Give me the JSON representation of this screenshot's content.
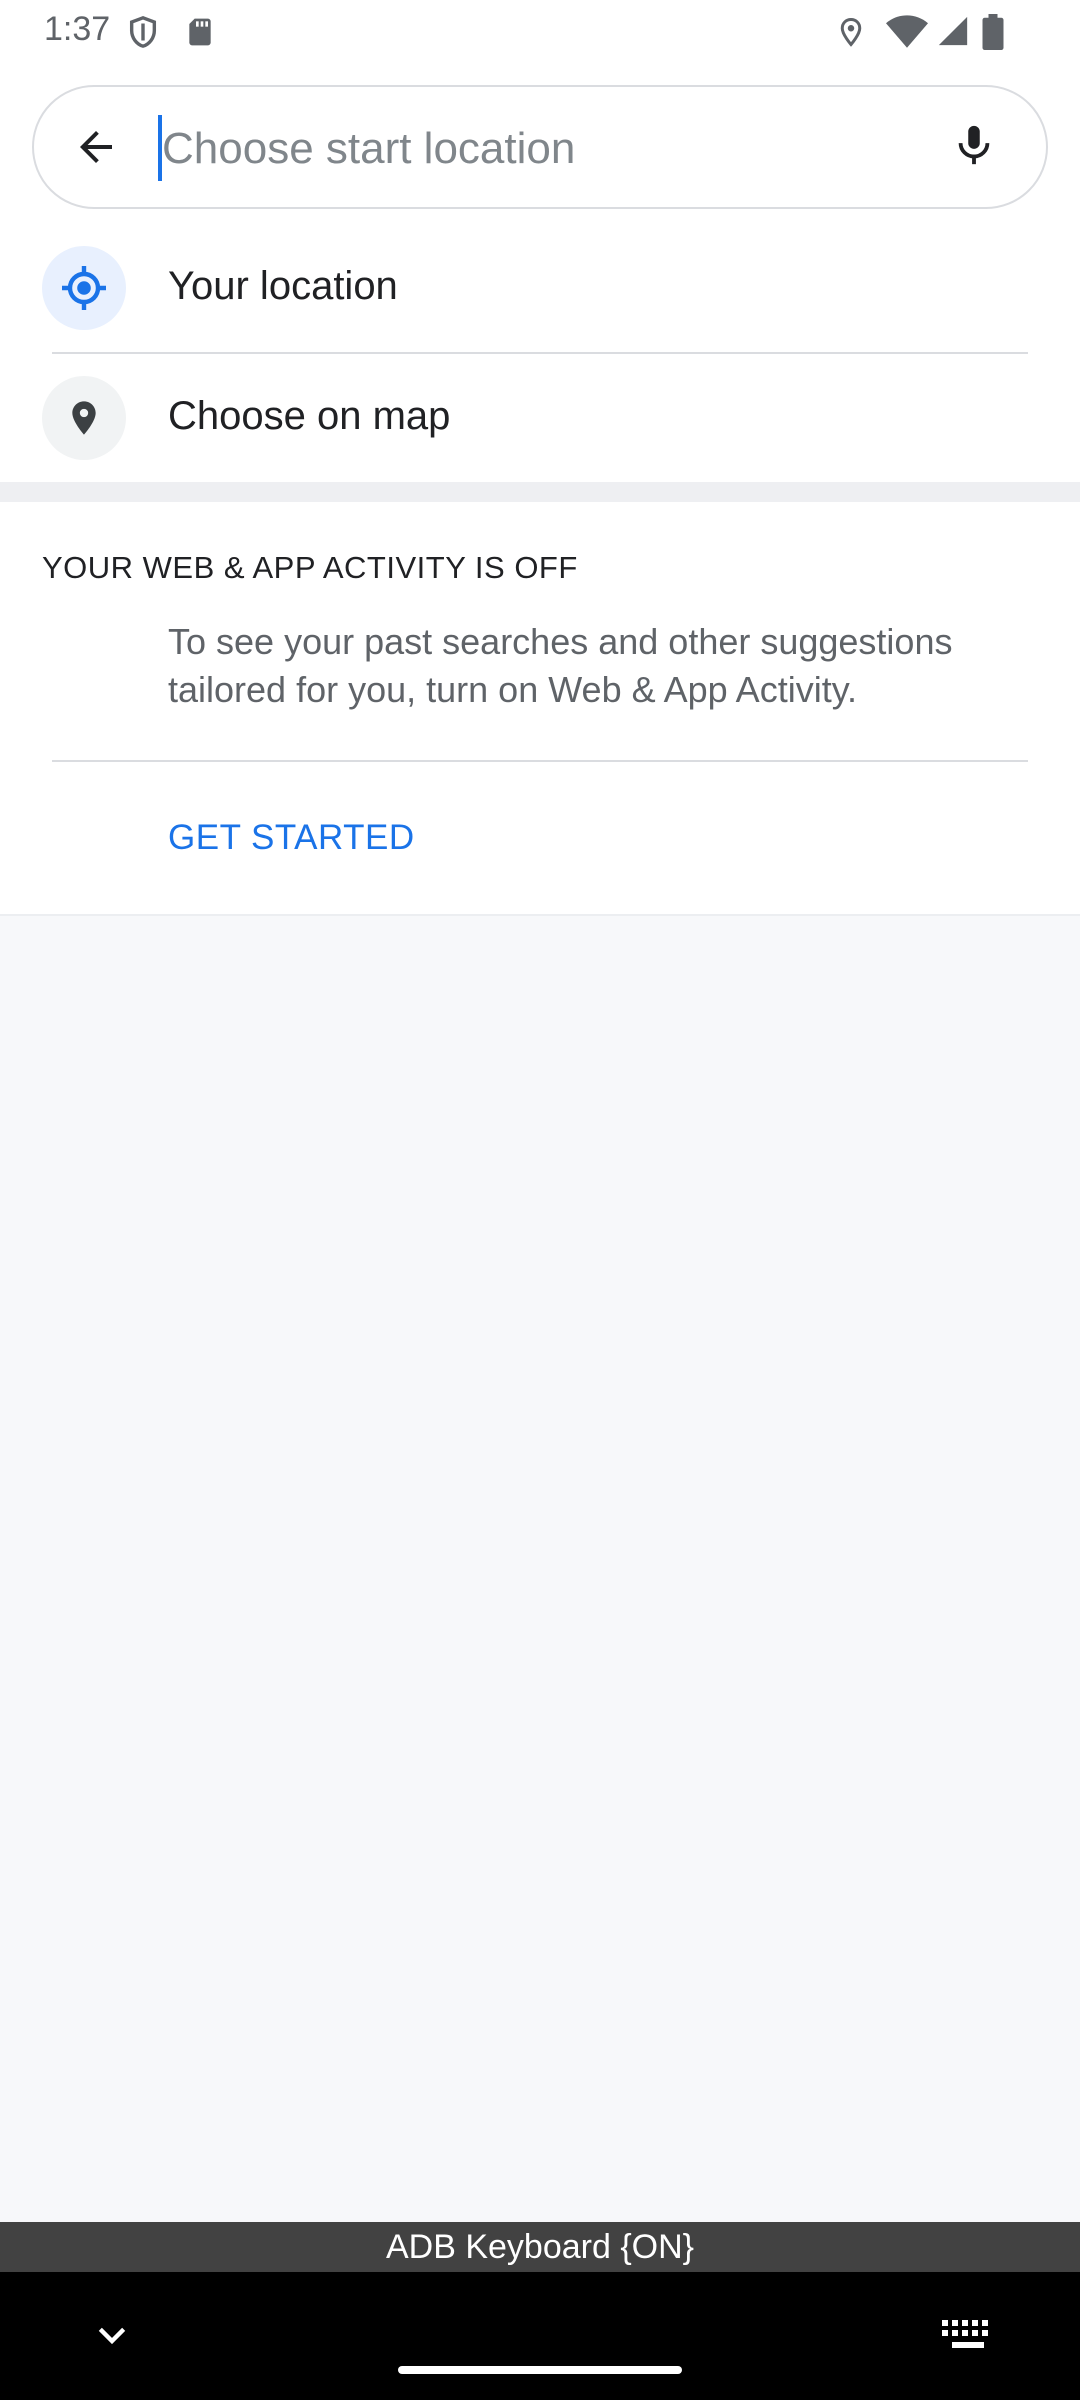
{
  "status_bar": {
    "time": "1:37",
    "left_icons": [
      "shield-icon",
      "sd-card-icon"
    ],
    "right_icons": [
      "location-icon",
      "wifi-icon",
      "signal-icon",
      "battery-icon"
    ]
  },
  "search": {
    "placeholder": "Choose start location",
    "value": "",
    "back_icon": "arrow-back-icon",
    "mic_icon": "mic-icon"
  },
  "suggestions": [
    {
      "label": "Your location",
      "icon": "my-location-icon",
      "icon_color": "#1a73e8",
      "icon_bg": "#e8f0fe"
    },
    {
      "label": "Choose on map",
      "icon": "map-pin-icon",
      "icon_color": "#3c4043",
      "icon_bg": "#f1f3f4"
    }
  ],
  "activity": {
    "title": "YOUR WEB & APP ACTIVITY IS OFF",
    "body": "To see your past searches and other suggestions tailored for you, turn on Web & App Activity.",
    "action_label": "GET STARTED",
    "accent_color": "#1a73e8"
  },
  "keyboard_banner": {
    "text": "ADB Keyboard {ON}"
  },
  "nav_bar": {
    "icons": [
      "chevron-down-icon",
      "home-handle",
      "keyboard-icon"
    ]
  }
}
